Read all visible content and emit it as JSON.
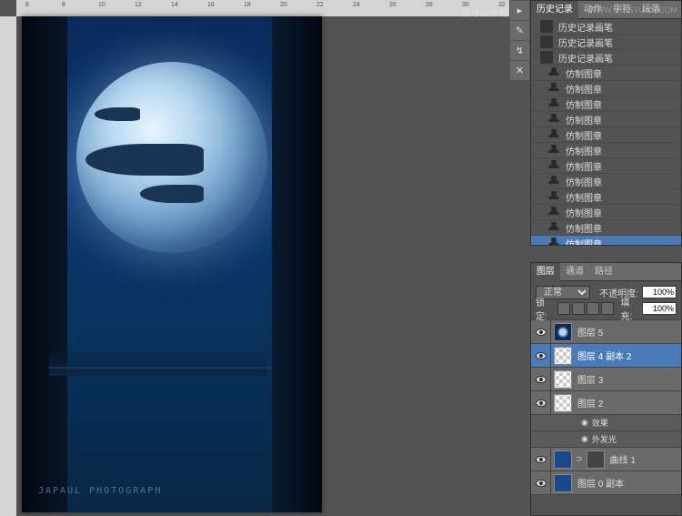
{
  "ruler_marks": [
    6,
    8,
    10,
    12,
    14,
    16,
    18,
    20,
    22,
    24,
    26,
    28,
    30,
    32
  ],
  "canvas": {
    "photo_credit": "JAPAUL PHOTOGRAPH"
  },
  "watermark": "思缘设计论坛",
  "watermark2": "WWW.MISSYUAN.COM",
  "history_panel": {
    "tabs": [
      "历史记录",
      "动作",
      "字符",
      "段落"
    ],
    "active_tab": 0,
    "items": [
      {
        "icon": "brush",
        "label": "历史记录画笔"
      },
      {
        "icon": "brush",
        "label": "历史记录画笔"
      },
      {
        "icon": "brush",
        "label": "历史记录画笔"
      },
      {
        "icon": "stamp",
        "label": "仿制图章"
      },
      {
        "icon": "stamp",
        "label": "仿制图章"
      },
      {
        "icon": "stamp",
        "label": "仿制图章"
      },
      {
        "icon": "stamp",
        "label": "仿制图章"
      },
      {
        "icon": "stamp",
        "label": "仿制图章"
      },
      {
        "icon": "stamp",
        "label": "仿制图章"
      },
      {
        "icon": "stamp",
        "label": "仿制图章"
      },
      {
        "icon": "stamp",
        "label": "仿制图章"
      },
      {
        "icon": "stamp",
        "label": "仿制图章"
      },
      {
        "icon": "stamp",
        "label": "仿制图章"
      },
      {
        "icon": "stamp",
        "label": "仿制图章"
      },
      {
        "icon": "stamp",
        "label": "仿制图章",
        "selected": true
      }
    ]
  },
  "layers_panel": {
    "tabs": [
      "图层",
      "通道",
      "路径"
    ],
    "active_tab": 0,
    "blend_mode": "正常",
    "opacity_label": "不透明度:",
    "opacity_value": "100%",
    "lock_label": "锁定:",
    "fill_label": "填充:",
    "fill_value": "100%",
    "layers": [
      {
        "visible": true,
        "thumb": "moon",
        "name": "图层 5"
      },
      {
        "visible": true,
        "thumb": "trans",
        "name": "图层 4 副本 2",
        "selected": true
      },
      {
        "visible": true,
        "thumb": "trans",
        "name": "图层 3"
      },
      {
        "visible": true,
        "thumb": "trans",
        "name": "图层 2",
        "has_effects": true
      },
      {
        "fx": true,
        "name": "效果"
      },
      {
        "fx": true,
        "name": "外发光"
      },
      {
        "visible": true,
        "thumb": "blue",
        "linked": true,
        "linked_thumb": "curve",
        "name": "曲线 1"
      },
      {
        "visible": true,
        "thumb": "blue",
        "name": "图层 0 副本"
      }
    ]
  }
}
